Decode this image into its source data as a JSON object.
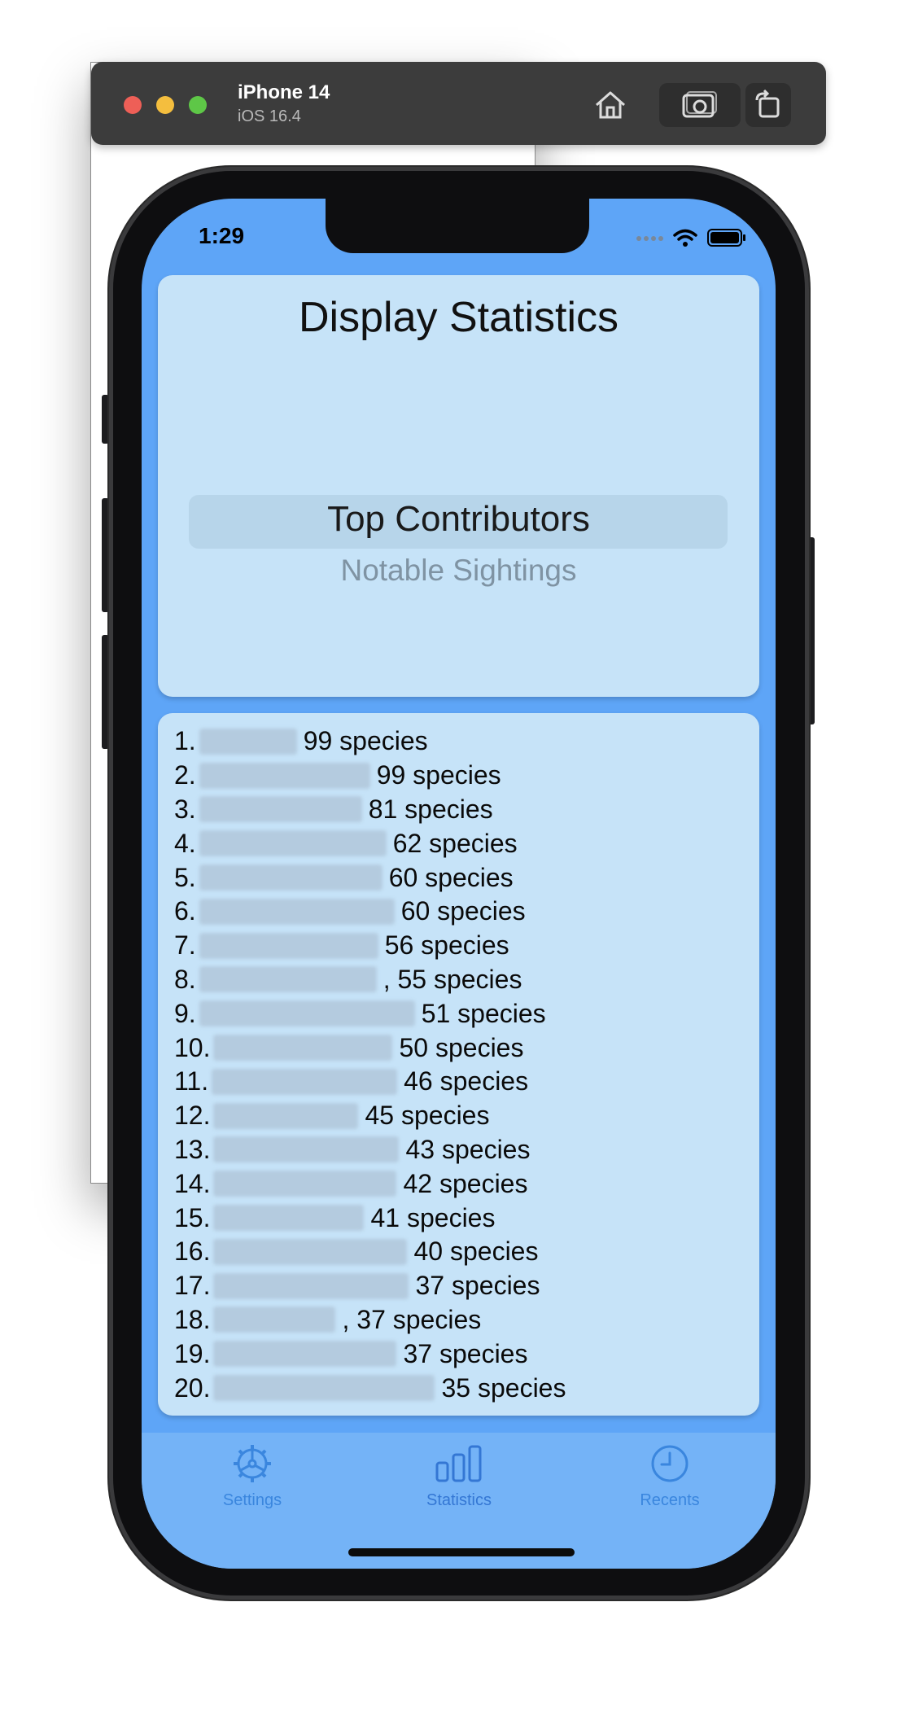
{
  "simulator": {
    "device_name": "iPhone 14",
    "os_version": "iOS 16.4"
  },
  "status_bar": {
    "time": "1:29"
  },
  "header": {
    "title": "Display Statistics"
  },
  "picker": {
    "selected": "Top Contributors",
    "other": "Notable Sightings"
  },
  "contributors": [
    {
      "rank": "1.",
      "name_width": 120,
      "suffix": "99 species"
    },
    {
      "rank": "2.",
      "name_width": 210,
      "suffix": "99 species"
    },
    {
      "rank": "3.",
      "name_width": 200,
      "suffix": "81 species"
    },
    {
      "rank": "4.",
      "name_width": 230,
      "suffix": "62 species"
    },
    {
      "rank": "5.",
      "name_width": 225,
      "suffix": "60 species"
    },
    {
      "rank": "6.",
      "name_width": 240,
      "suffix": "60 species"
    },
    {
      "rank": "7.",
      "name_width": 220,
      "suffix": "56 species"
    },
    {
      "rank": "8.",
      "name_width": 218,
      "suffix": ", 55 species"
    },
    {
      "rank": "9.",
      "name_width": 265,
      "suffix": "51 species"
    },
    {
      "rank": "10.",
      "name_width": 220,
      "suffix": "50 species"
    },
    {
      "rank": "11.",
      "name_width": 228,
      "suffix": "46 species"
    },
    {
      "rank": "12.",
      "name_width": 178,
      "suffix": "45 species"
    },
    {
      "rank": "13.",
      "name_width": 228,
      "suffix": "43 species"
    },
    {
      "rank": "14.",
      "name_width": 225,
      "suffix": "42 species"
    },
    {
      "rank": "15.",
      "name_width": 185,
      "suffix": "41 species"
    },
    {
      "rank": "16.",
      "name_width": 238,
      "suffix": "40 species"
    },
    {
      "rank": "17.",
      "name_width": 240,
      "suffix": "37 species"
    },
    {
      "rank": "18.",
      "name_width": 150,
      "suffix": ", 37 species"
    },
    {
      "rank": "19.",
      "name_width": 225,
      "suffix": "37 species"
    },
    {
      "rank": "20.",
      "name_width": 272,
      "suffix": "35 species"
    }
  ],
  "tabs": [
    {
      "label": "Settings",
      "icon": "gear-icon"
    },
    {
      "label": "Statistics",
      "icon": "bar-chart-icon",
      "active": true
    },
    {
      "label": "Recents",
      "icon": "clock-icon"
    }
  ],
  "colors": {
    "screen_bg": "#5ea5f7",
    "card_bg": "#c6e3f8",
    "tab_bar_bg": "#74b3f7",
    "tab_accent": "#3a86de"
  }
}
